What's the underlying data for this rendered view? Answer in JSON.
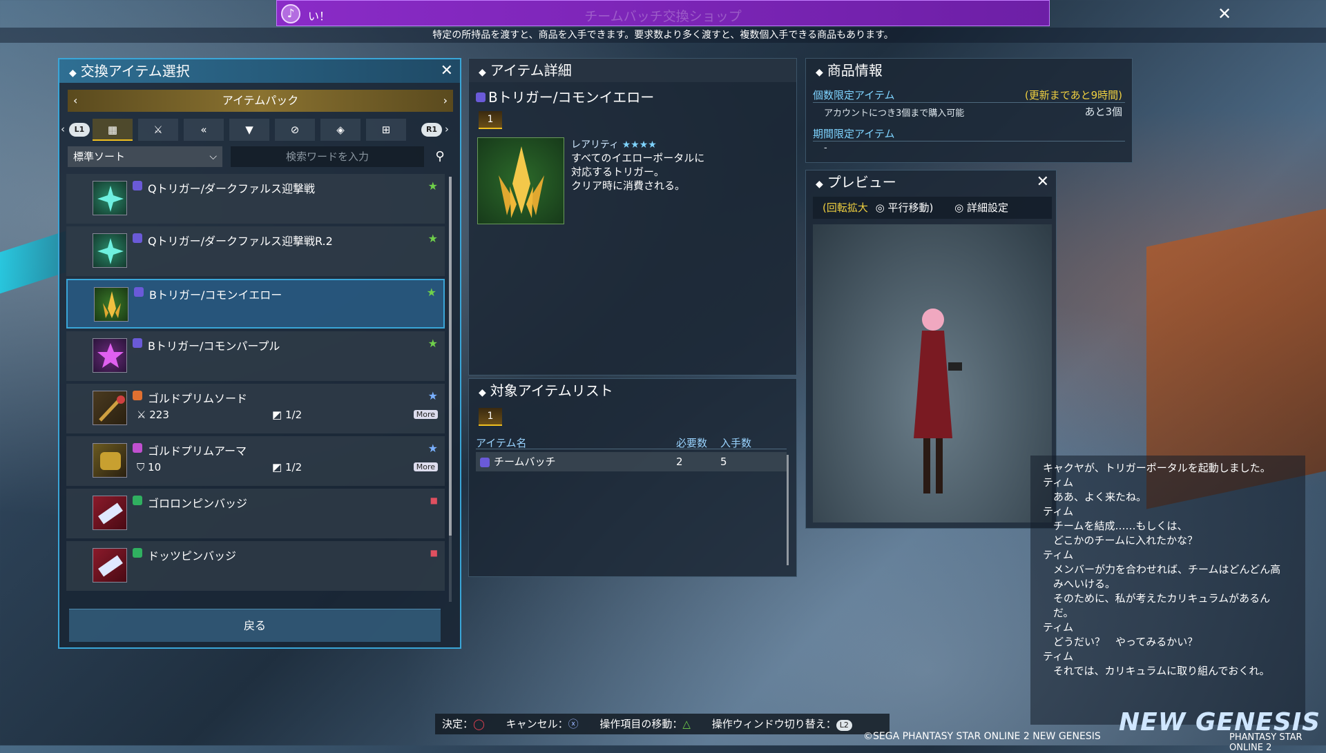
{
  "banner": {
    "speaker": "い！",
    "title": "チームバッチ交換ショップ",
    "close": "✕"
  },
  "subtitle": "特定の所持品を渡すと、商品を入手できます。要求数より多く渡すと、複数個入手できる商品もあります。",
  "left_panel": {
    "title": "交換アイテム選択",
    "bag_label": "アイテムパック",
    "tabs": {
      "l1": "L1",
      "r1": "R1"
    },
    "sort_label": "標準ソート",
    "search_placeholder": "検索ワードを入力",
    "items": [
      {
        "name": "Qトリガー/ダークファルス迎撃戦"
      },
      {
        "name": "Qトリガー/ダークファルス迎撃戦R.2"
      },
      {
        "name": "Bトリガー/コモンイエロー"
      },
      {
        "name": "Bトリガー/コモンパープル"
      },
      {
        "name": "ゴルドプリムソード",
        "stat": "223",
        "slot": "1/2",
        "more": "More"
      },
      {
        "name": "ゴルドプリムアーマ",
        "stat": "10",
        "slot": "1/2",
        "more": "More"
      },
      {
        "name": "ゴロロンピンバッジ"
      },
      {
        "name": "ドッツピンバッジ"
      }
    ],
    "back_label": "戻る"
  },
  "detail": {
    "title": "アイテム詳細",
    "item_name": "Bトリガー/コモンイエロー",
    "qty_badge": "1",
    "rarity_label": "レアリティ",
    "rarity_stars": "★★★★",
    "description": "すべてのイエローポータルに\n対応するトリガー。\nクリア時に消費される。"
  },
  "target_list": {
    "title": "対象アイテムリスト",
    "qty_badge": "1",
    "col_name": "アイテム名",
    "col_required": "必要数",
    "col_obtain": "入手数",
    "rows": [
      {
        "name": "チームバッチ",
        "required": "2",
        "obtain": "5"
      }
    ]
  },
  "product_info": {
    "title": "商品情報",
    "limited_label": "個数限定アイテム",
    "limited_update": "(更新まであと9時間)",
    "limited_note": "アカウントにつき3個まで購入可能",
    "limited_remaining": "あと3個",
    "period_label": "期間限定アイテム",
    "period_value": "-"
  },
  "preview": {
    "title": "プレビュー",
    "controls": [
      "(回転拡大",
      "平行移動)",
      "詳細設定"
    ]
  },
  "chat": "キャクヤが、トリガーポータルを起動しました。\nティム\n　ああ、よく来たね。\nティム\n　チームを結成……もしくは、\n　どこかのチームに入れたかな？\nティム\n　メンバーが力を合わせれば、チームはどんどん高\n　みへいける。\n　そのために、私が考えたカリキュラムがあるん\n　だ。\nティム\n　どうだい？　やってみるかい？\nティム\n　それでは、カリキュラムに取り組んでおくれ。",
  "bottom_bar": {
    "confirm": "決定：",
    "cancel": "キャンセル：",
    "move": "操作項目の移動：",
    "switch": "操作ウィンドウ切り替え：",
    "l2": "L2"
  },
  "copyright": "©SEGA PHANTASY STAR ONLINE 2 NEW GENESIS",
  "logo": {
    "main": "NEW GENESIS",
    "sub": "PHANTASY STAR ONLINE 2"
  }
}
